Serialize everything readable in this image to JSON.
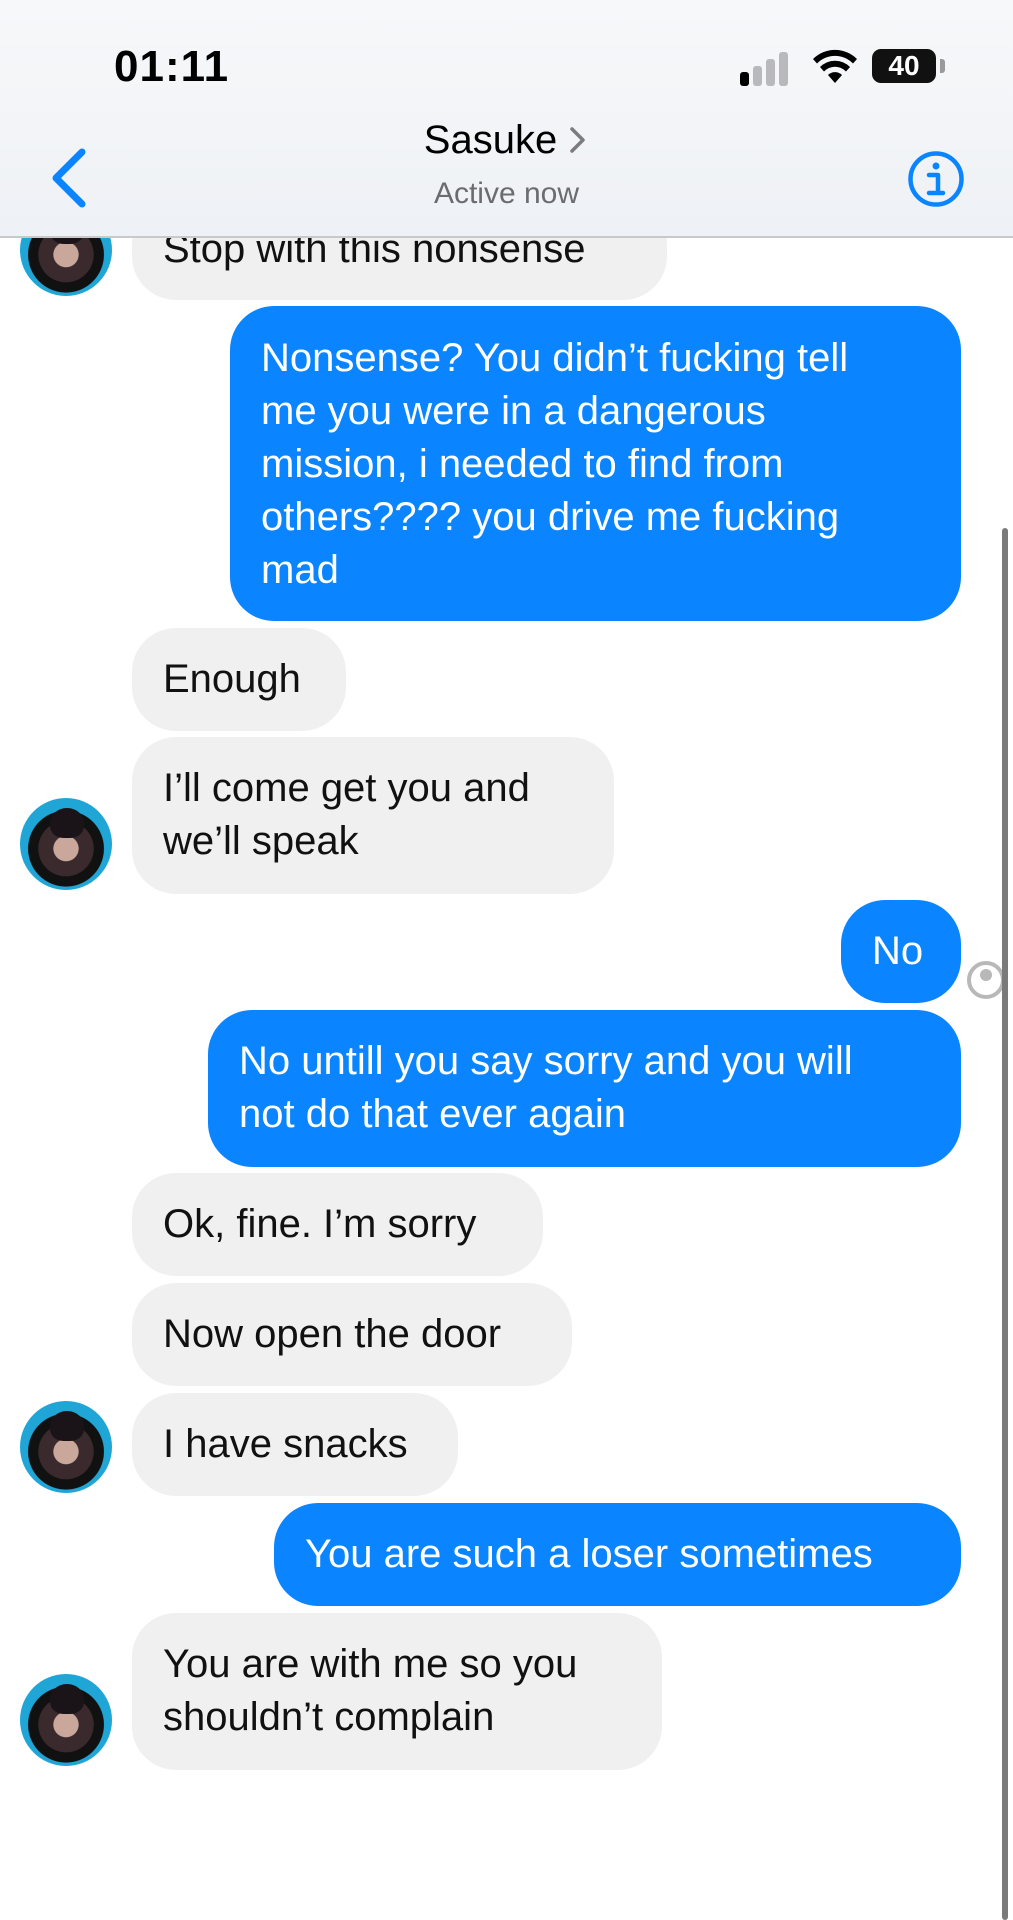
{
  "status_bar": {
    "time": "01:11",
    "battery": "40",
    "icons": [
      "cellular-signal-icon",
      "wifi-icon",
      "battery-icon"
    ]
  },
  "header": {
    "contact_name": "Sasuke",
    "status": "Active now",
    "back_icon": "chevron-left-icon",
    "info_icon": "info-icon",
    "accent": "#0a84ff"
  },
  "messages": [
    {
      "from": "them",
      "text": "Stop with this nonsense"
    },
    {
      "from": "me",
      "text": "Nonsense? You didn’t fucking tell\nme you were in a dangerous\nmission, i needed to find from\nothers???? you drive me fucking\nmad"
    },
    {
      "from": "them",
      "text": "Enough"
    },
    {
      "from": "them",
      "text": "I’ll come get you and\nwe’ll speak"
    },
    {
      "from": "me",
      "text": "No"
    },
    {
      "from": "me",
      "text": "No untill you say sorry and you will\nnot do that ever again"
    },
    {
      "from": "them",
      "text": "Ok, fine. I’m sorry"
    },
    {
      "from": "them",
      "text": "Now open the door"
    },
    {
      "from": "them",
      "text": "I have snacks"
    },
    {
      "from": "me",
      "text": "You are such a loser sometimes"
    },
    {
      "from": "them",
      "text": "You are with me so you\nshouldn’t complain"
    }
  ],
  "colors": {
    "outgoing_bubble": "#0a84ff",
    "incoming_bubble": "#f0f0f0"
  }
}
